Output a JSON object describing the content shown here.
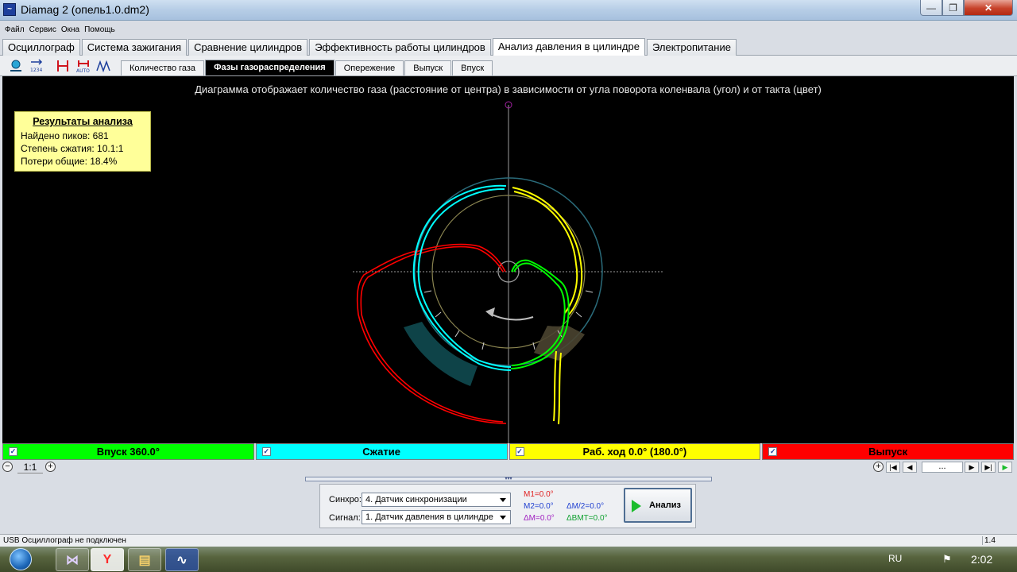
{
  "window": {
    "title": "Diamag 2 (опель1.0.dm2)",
    "min_glyph": "—",
    "max_glyph": "❐",
    "close_glyph": "✕"
  },
  "menu": [
    "Файл",
    "Сервис",
    "Окна",
    "Помощь"
  ],
  "main_tabs": [
    "Осциллограф",
    "Система зажигания",
    "Сравнение цилиндров",
    "Эффективность работы цилиндров",
    "Анализ давления в цилиндре",
    "Электропитание"
  ],
  "main_tabs_active": 4,
  "toolbar_icons": [
    "connect-icon",
    "counter-icon",
    "cursors-icon",
    "auto-icon",
    "measure-icon"
  ],
  "sub_tabs": [
    "Количество газа",
    "Фазы газораспределения",
    "Опережение",
    "Выпуск",
    "Впуск"
  ],
  "sub_tabs_active": 1,
  "plot": {
    "description": "Диаграмма отображает количество газа (расстояние от центра) в зависимости от угла поворота коленвала (угол) и от такта (цвет)",
    "results_title": "Результаты анализа",
    "results": [
      "Найдено пиков: 681",
      "Степень сжатия: 10.1:1",
      "Потери общие: 18.4%"
    ],
    "stroke_colors": {
      "intake": "#00ff00",
      "compression": "#00ffff",
      "power": "#ffff00",
      "exhaust": "#ff0000"
    }
  },
  "legend": [
    {
      "label": "Впуск 360.0°",
      "color": "#00ff00"
    },
    {
      "label": "Сжатие",
      "color": "#00ffff"
    },
    {
      "label": "Раб. ход 0.0° (180.0°)",
      "color": "#ffff00"
    },
    {
      "label": "Выпуск",
      "color": "#ff0000"
    }
  ],
  "zoom": {
    "out_glyph": "−",
    "label": "1:1",
    "in_glyph": "+"
  },
  "nav": {
    "add_glyph": "+",
    "first_glyph": "|◀",
    "prev_glyph": "◀",
    "field": "...",
    "next_glyph": "▶",
    "last_glyph": "▶|",
    "play_glyph": "▶"
  },
  "controls": {
    "collapse_glyph": "▾▾▾",
    "sync_label": "Синхро:",
    "sync_value": "4.  Датчик синхронизации",
    "signal_label": "Сигнал:",
    "signal_value": "1.  Датчик давления в цилиндре",
    "m1": "M1=0.0°",
    "m2": "M2=0.0°",
    "dm": "ΔM=0.0°",
    "dm2": "ΔM/2=0.0°",
    "dbmt": "ΔВМТ=0.0°",
    "analyze_label": "Анализ"
  },
  "status": {
    "text": "USB Осциллограф не подключен",
    "version": "1.4"
  },
  "taskbar": {
    "apps": [
      "vs-icon",
      "yandex-browser-icon",
      "explorer-icon",
      "diamag-icon"
    ],
    "app_glyphs": [
      "⋈",
      "Y",
      "▤",
      "∿"
    ],
    "lang": "RU",
    "flag_glyph": "⚑",
    "clock": "2:02"
  }
}
